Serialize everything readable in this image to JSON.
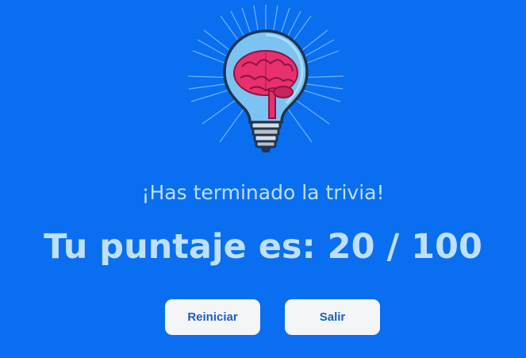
{
  "result": {
    "message": "¡Has terminado la trivia!",
    "score_label": "Tu puntaje es: 20 / 100",
    "score": 20,
    "max_score": 100
  },
  "actions": {
    "restart_label": "Reiniciar",
    "exit_label": "Salir"
  },
  "logo": {
    "icon": "brain-lightbulb-icon"
  },
  "colors": {
    "background": "#0a6ef0",
    "text": "#bfe0fb",
    "button_bg": "#f4f5f7",
    "button_text": "#1a5fbf",
    "brain": "#e8306f"
  }
}
